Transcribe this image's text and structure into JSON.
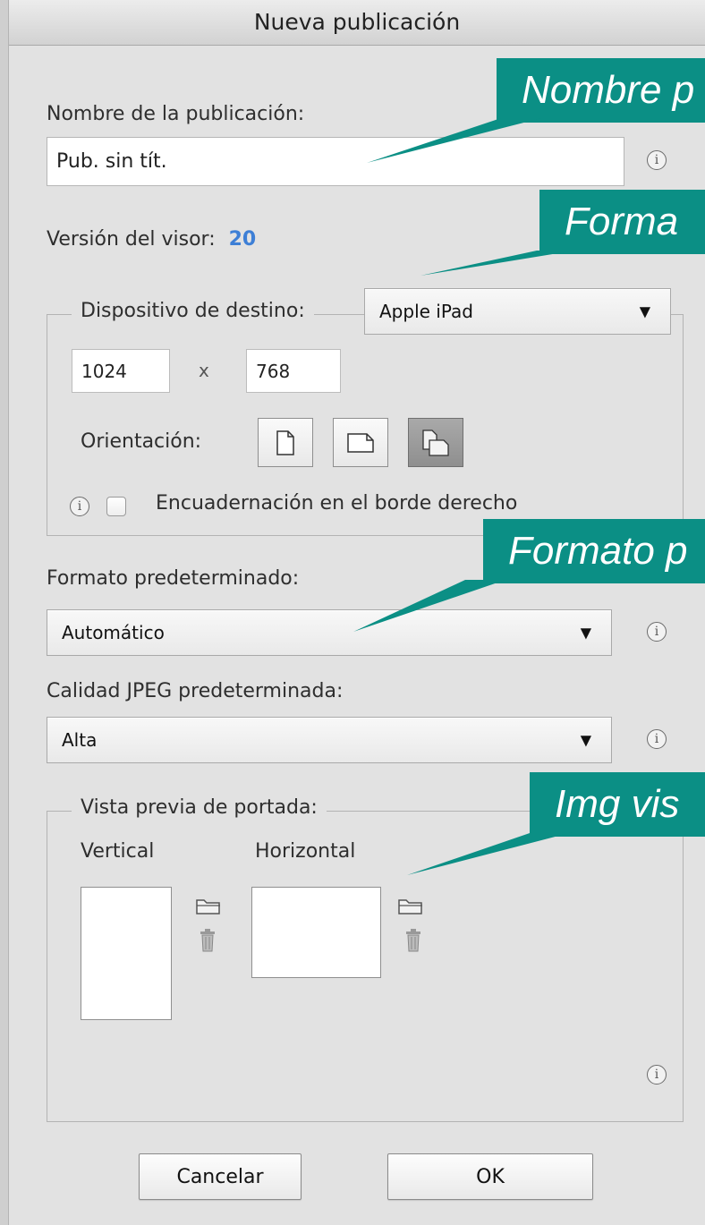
{
  "dialog": {
    "title": "Nueva publicación"
  },
  "publication": {
    "name_label": "Nombre de la publicación:",
    "name_value": "Pub. sin tít.",
    "viewer_label": "Versión del visor:",
    "viewer_value": "20"
  },
  "target_device": {
    "group_label": "Dispositivo de destino:",
    "device_value": "Apple iPad",
    "width": "1024",
    "separator": "x",
    "height": "768",
    "orientation_label": "Orientación:",
    "binding_label": "Encuadernación en el borde derecho",
    "binding_checked": false
  },
  "default_format": {
    "label": "Formato predeterminado:",
    "value": "Automático"
  },
  "jpeg_quality": {
    "label": "Calidad JPEG predeterminada:",
    "value": "Alta"
  },
  "cover_preview": {
    "group_label": "Vista previa de portada:",
    "vertical_label": "Vertical",
    "horizontal_label": "Horizontal"
  },
  "buttons": {
    "cancel": "Cancelar",
    "ok": "OK"
  },
  "callouts": {
    "name": "Nombre p",
    "format": "Forma",
    "default_format": "Formato p",
    "preview": "Img vis"
  },
  "colors": {
    "callout": "#0b8f85",
    "viewer_version": "#3d7fd6"
  },
  "icons": {
    "info": "info-icon",
    "folder": "folder-icon",
    "trash": "trash-icon",
    "dropdown": "chevron-down-icon"
  }
}
